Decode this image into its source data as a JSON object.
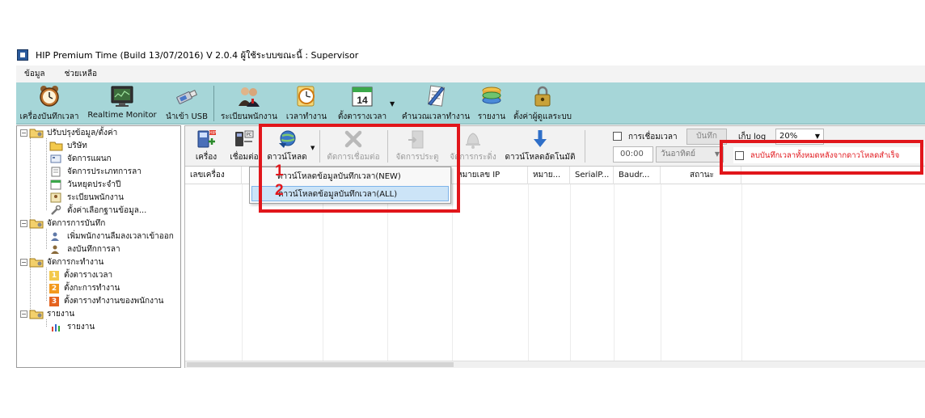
{
  "window": {
    "title": "HIP Premium Time (Build 13/07/2016) V 2.0.4   ผู้ใช้ระบบขณะนี้ : Supervisor"
  },
  "menubar": [
    "ข้อมูล",
    "ช่วยเหลือ"
  ],
  "main_toolbar": [
    {
      "label": "เครื่องบันทึกเวลา",
      "icon": "alarm-clock-icon"
    },
    {
      "label": "Realtime Monitor",
      "icon": "monitor-icon"
    },
    {
      "label": "นำเข้า USB",
      "icon": "usb-drive-icon"
    },
    {
      "label": "ระเบียนพนักงาน",
      "icon": "people-icon"
    },
    {
      "label": "เวลาทำงาน",
      "icon": "clock-icon"
    },
    {
      "label": "ตั้งตารางเวลา",
      "icon": "calendar-icon"
    },
    {
      "label": "คำนวณเวลาทำงาน",
      "icon": "calculate-icon"
    },
    {
      "label": "รายงาน",
      "icon": "database-icon"
    },
    {
      "label": "ตั้งค่าผู้ดูแลระบบ",
      "icon": "lock-admin-icon"
    }
  ],
  "calendar_day": "14",
  "tree": {
    "groups": [
      {
        "label": "ปรับปรุงข้อมูล/ตั้งค่า",
        "items": [
          "บริษัท",
          "จัดการแผนก",
          "จัดการประเภทการลา",
          "วันหยุดประจำปี",
          "ระเบียนพนักงาน",
          "ตั้งค่าเลือกฐานข้อมูล..."
        ]
      },
      {
        "label": "จัดการการบันทึก",
        "items": [
          "เพิ่มพนักงานลืมลงเวลาเข้าออก",
          "ลงบันทึกการลา"
        ]
      },
      {
        "label": "จัดการกะทำงาน",
        "items": [
          "ตั้งตารางเวลา",
          "ตั้งกะการทำงาน",
          "ตั้งตารางทำงานของพนักงาน"
        ]
      },
      {
        "label": "รายงาน",
        "items": [
          "รายงาน"
        ]
      }
    ],
    "item_badges": [
      "1",
      "2",
      "3"
    ]
  },
  "sub_toolbar": {
    "buttons": [
      {
        "label": "เครื่อง",
        "enabled": true
      },
      {
        "label": "เชื่อมต่อ",
        "enabled": true
      },
      {
        "label": "ดาวน์โหลด",
        "enabled": true
      },
      {
        "label": "ตัดการเชื่อมต่อ",
        "enabled": false
      },
      {
        "label": "จัดการประตู",
        "enabled": false
      },
      {
        "label": "จัดการกระดิ่ง",
        "enabled": false
      },
      {
        "label": "ดาวน์โหลดอัตโนมัติ",
        "enabled": true
      }
    ],
    "timer_checkbox_label": "การเชื่อมเวลา",
    "save_button": "บันทึก",
    "time_value": "00:00",
    "day_value": "วันอาทิตย์",
    "log_label": "เก็บ log",
    "log_value": "20%",
    "delete_checkbox_label": "ลบบันทึกเวลาทั้งหมดหลังจากดาวโหลดสำเร็จ"
  },
  "grid": {
    "columns": [
      "เลขเครื่อง",
      "",
      "",
      "",
      "",
      "หมายเลข IP",
      "หมาย...",
      "SerialP...",
      "Baudr...",
      "สถานะ"
    ]
  },
  "download_menu": {
    "items": [
      "ดาวน์โหลดข้อมูลบันทึกเวลา(NEW)",
      "ดาวน์โหลดข้อมูลบันทึกเวลา(ALL)"
    ]
  },
  "annotations": [
    "1",
    "2"
  ],
  "colors": {
    "toolbar_bg": "#a6d6d8",
    "annotation_red": "#e1161b",
    "menu_highlight": "#cce4f7"
  }
}
